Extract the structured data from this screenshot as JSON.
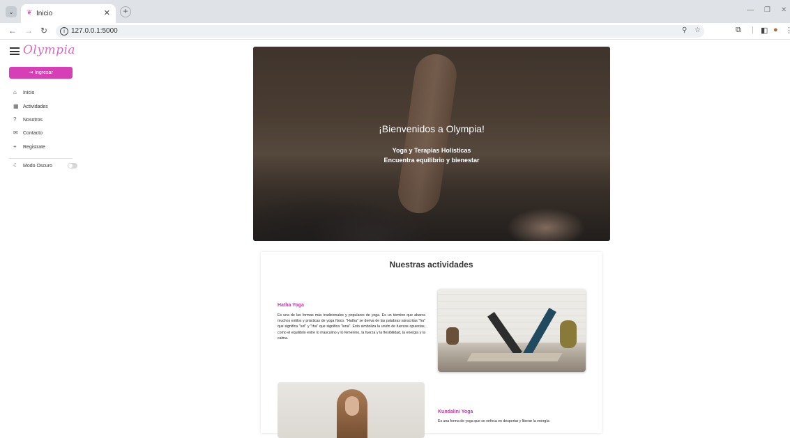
{
  "browser": {
    "tab_title": "Inicio",
    "url": "127.0.0.1:5000"
  },
  "icons": {
    "tab_dropdown": "chevron-down-icon",
    "favicon": "olympia-favicon",
    "close": "close-icon",
    "new_tab": "plus-icon",
    "back": "back-arrow-icon",
    "forward": "forward-arrow-icon",
    "reload": "reload-icon",
    "site_info": "info-icon",
    "zoom": "zoom-icon",
    "bookmark": "star-icon",
    "extensions": "extensions-icon",
    "side_panel": "side-panel-icon",
    "profile": "avatar-icon",
    "menu": "more-vertical-icon"
  },
  "sidebar": {
    "logo": "Olympia",
    "login_label": "Ingresar",
    "items": [
      {
        "label": "Inicio",
        "icon": "home-icon"
      },
      {
        "label": "Actividades",
        "icon": "activities-icon"
      },
      {
        "label": "Nosotros",
        "icon": "question-icon"
      },
      {
        "label": "Contacto",
        "icon": "mail-icon"
      },
      {
        "label": "Registrate",
        "icon": "plus-icon"
      }
    ],
    "dark_mode_label": "Modo Oscuro",
    "dark_mode_on": false
  },
  "hero": {
    "title": "¡Bienvenidos a Olympia!",
    "subtitle1": "Yoga y Terapias Holísticas",
    "subtitle2": "Encuentra equilibrio y bienestar"
  },
  "activities": {
    "title": "Nuestras actividades",
    "items": [
      {
        "title": "Hatha Yoga",
        "description": "Es una de las formas más tradicionales y populares de yoga. Es un término que abarca muchos estilos y prácticas de yoga físico. \"Hatha\" se deriva de las palabras sánscritas \"ha\" que significa \"sol\" y \"tha\" que significa \"luna\". Esto simboliza la unión de fuerzas opuestas, como el equilibrio entre lo masculino y lo femenino, la fuerza y la flexibilidad, la energía y la calma."
      },
      {
        "title": "Kundalini Yoga",
        "description": "Es una forma de yoga que se enfoca en despertar y liberar la energía"
      }
    ]
  },
  "colors": {
    "accent": "#d63fb6",
    "activity_title": "#c13aa6"
  }
}
